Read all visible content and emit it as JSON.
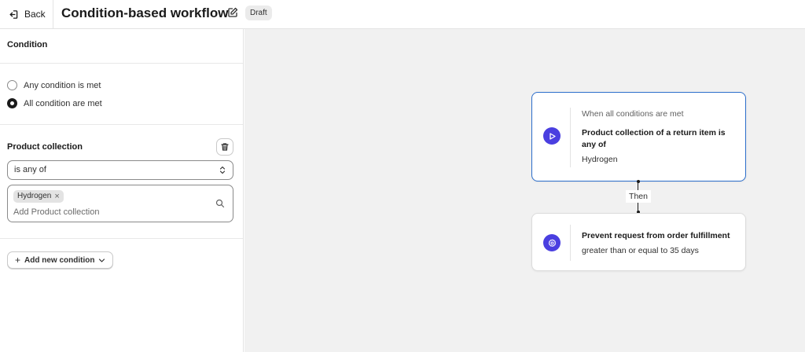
{
  "header": {
    "back_label": "Back",
    "title": "Condition-based workflow",
    "status_badge": "Draft"
  },
  "sidebar": {
    "condition_title": "Condition",
    "match_options": [
      {
        "label": "Any condition is met",
        "checked": false
      },
      {
        "label": "All condition are met",
        "checked": true
      }
    ],
    "rule": {
      "field_label": "Product collection",
      "operator": "is any of",
      "tags": [
        "Hydrogen"
      ],
      "placeholder": "Add Product collection"
    },
    "add_condition_label": "Add new condition"
  },
  "flow": {
    "trigger_card": {
      "label": "When all conditions are met",
      "condition": "Product collection of a return item is any of",
      "value": "Hydrogen"
    },
    "then_label": "Then",
    "action_card": {
      "action": "Prevent request from order fulfillment",
      "detail": "greater than or equal to 35 days"
    }
  },
  "colors": {
    "accent": "#4a3fe0",
    "selected_border": "#2c6ecb",
    "canvas_bg": "#f1f1f1"
  },
  "icons": {
    "back": "exit-arrow-icon",
    "edit": "edit-icon",
    "delete": "trash-icon",
    "select": "up-down-chevron-icon",
    "search": "search-icon",
    "trigger": "play-icon",
    "action": "gear-icon"
  }
}
